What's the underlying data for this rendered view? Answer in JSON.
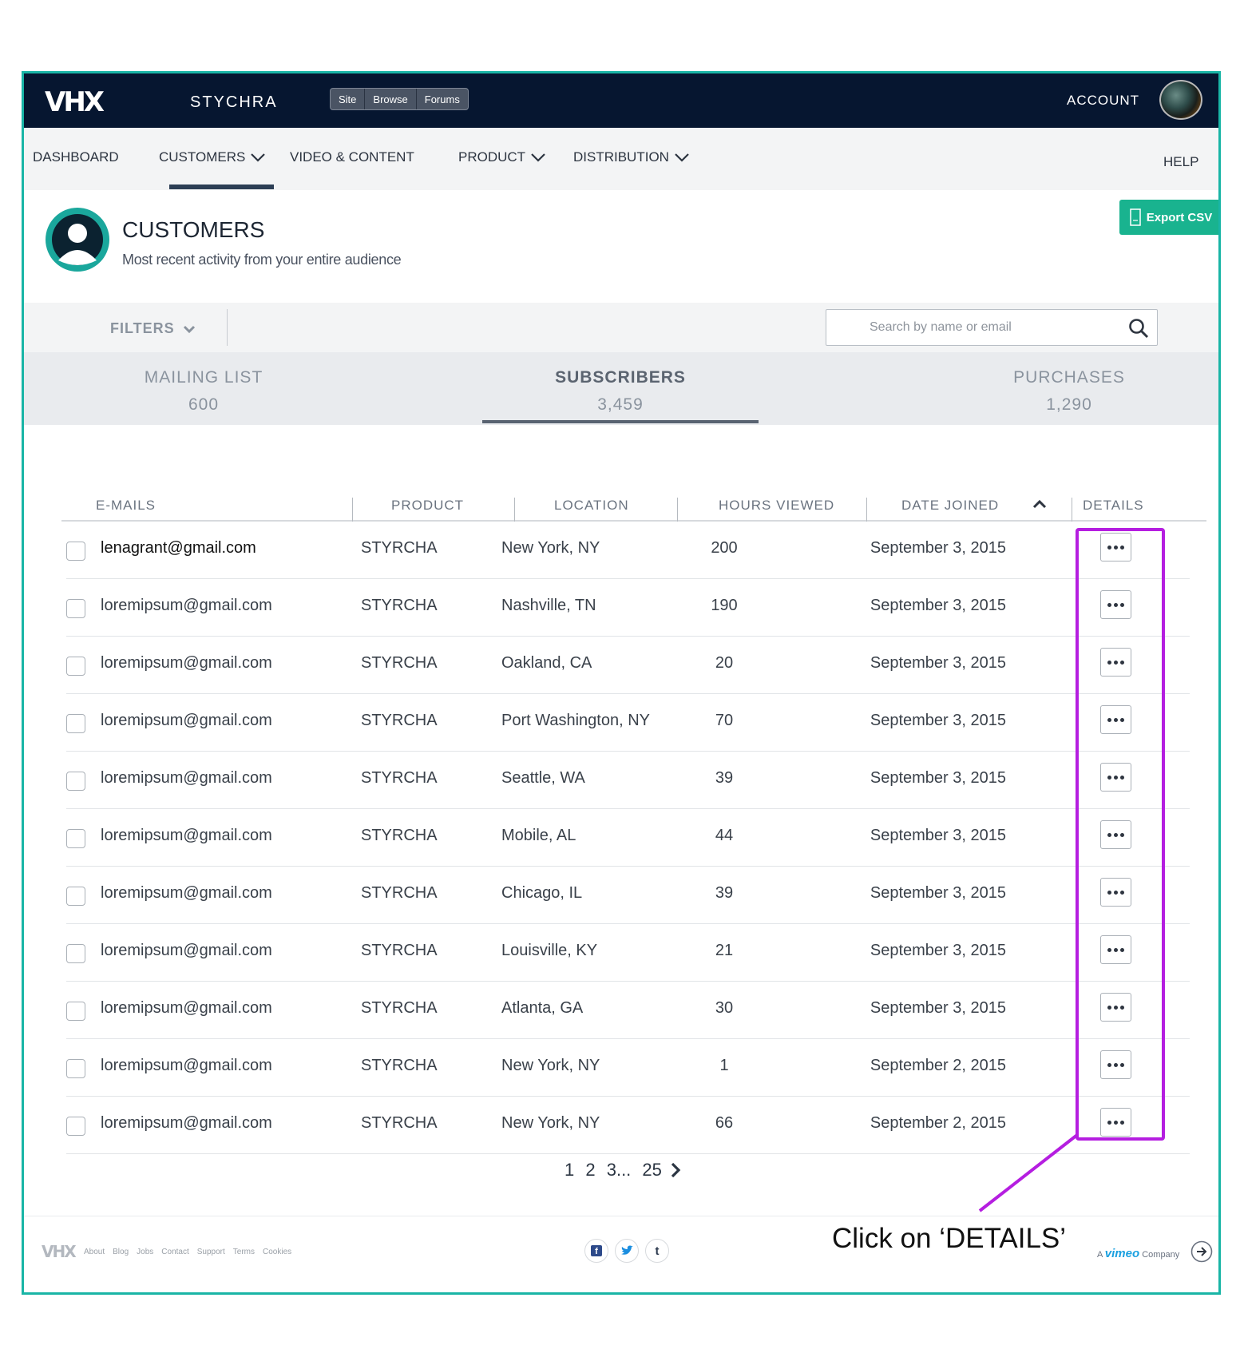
{
  "topbar": {
    "logo": "VHX",
    "site_name": "STYCHRA",
    "site_switch": [
      "Site",
      "Browse",
      "Forums"
    ],
    "account": "ACCOUNT"
  },
  "nav": {
    "dashboard": "DASHBOARD",
    "customers": "CUSTOMERS",
    "video_content": "VIDEO & CONTENT",
    "product": "PRODUCT",
    "distribution": "DISTRIBUTION",
    "help": "HELP"
  },
  "header": {
    "title": "CUSTOMERS",
    "subtitle": "Most recent activity from your entire audience",
    "export_label": "Export CSV"
  },
  "filters": {
    "label": "FILTERS",
    "search_placeholder": "Search by name or email"
  },
  "stats": [
    {
      "label": "MAILING LIST",
      "count": "600"
    },
    {
      "label": "SUBSCRIBERS",
      "count": "3,459"
    },
    {
      "label": "PURCHASES",
      "count": "1,290"
    }
  ],
  "table": {
    "headers": [
      "E-MAILS",
      "PRODUCT",
      "LOCATION",
      "HOURS VIEWED",
      "DATE JOINED",
      "DETAILS"
    ],
    "rows": [
      {
        "email": "lenagrant@gmail.com",
        "product": "STYRCHA",
        "location": "New York, NY",
        "hours": "200",
        "date": "September 3, 2015"
      },
      {
        "email": "loremipsum@gmail.com",
        "product": "STYRCHA",
        "location": "Nashville, TN",
        "hours": "190",
        "date": "September 3, 2015"
      },
      {
        "email": "loremipsum@gmail.com",
        "product": "STYRCHA",
        "location": "Oakland, CA",
        "hours": "20",
        "date": "September 3, 2015"
      },
      {
        "email": "loremipsum@gmail.com",
        "product": "STYRCHA",
        "location": "Port Washington, NY",
        "hours": "70",
        "date": "September 3, 2015"
      },
      {
        "email": "loremipsum@gmail.com",
        "product": "STYRCHA",
        "location": "Seattle, WA",
        "hours": "39",
        "date": "September 3, 2015"
      },
      {
        "email": "loremipsum@gmail.com",
        "product": "STYRCHA",
        "location": "Mobile, AL",
        "hours": "44",
        "date": "September 3, 2015"
      },
      {
        "email": "loremipsum@gmail.com",
        "product": "STYRCHA",
        "location": "Chicago, IL",
        "hours": "39",
        "date": "September 3, 2015"
      },
      {
        "email": "loremipsum@gmail.com",
        "product": "STYRCHA",
        "location": "Louisville, KY",
        "hours": "21",
        "date": "September 3, 2015"
      },
      {
        "email": "loremipsum@gmail.com",
        "product": "STYRCHA",
        "location": "Atlanta, GA",
        "hours": "30",
        "date": "September 3, 2015"
      },
      {
        "email": "loremipsum@gmail.com",
        "product": "STYRCHA",
        "location": "New York, NY",
        "hours": "1",
        "date": "September 2, 2015"
      },
      {
        "email": "loremipsum@gmail.com",
        "product": "STYRCHA",
        "location": "New York, NY",
        "hours": "66",
        "date": "September 2, 2015"
      }
    ]
  },
  "pagination": {
    "pages": [
      "1",
      "2",
      "3...",
      "25"
    ]
  },
  "footer": {
    "logo": "VHX",
    "links": [
      "About",
      "Blog",
      "Jobs",
      "Contact",
      "Support",
      "Terms",
      "Cookies"
    ],
    "social": [
      "f",
      "t",
      "t"
    ],
    "credit_prefix": "A",
    "credit_brand": "vimeo",
    "credit_suffix": "Company"
  },
  "annotation": {
    "text": "Click on ‘DETAILS’",
    "color": "#b51ee0"
  },
  "colors": {
    "brand_teal": "#19b5a6",
    "topbar": "#061630",
    "export_green": "#19b38f"
  }
}
